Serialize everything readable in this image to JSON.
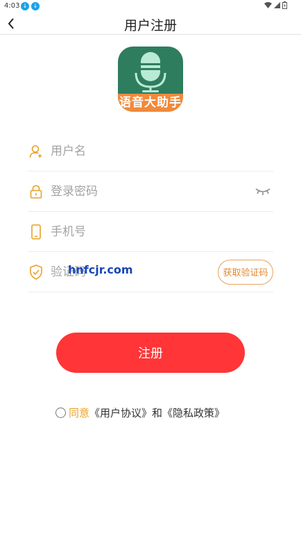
{
  "status_bar": {
    "time": "4:03"
  },
  "header": {
    "title": "用户注册"
  },
  "logo": {
    "text": "语音大助手"
  },
  "form": {
    "username": {
      "placeholder": "用户名"
    },
    "password": {
      "placeholder": "登录密码"
    },
    "phone": {
      "placeholder": "手机号"
    },
    "code": {
      "placeholder": "验证码",
      "button_label": "获取验证码"
    }
  },
  "watermark": "hnfcjr.com",
  "register_button": "注册",
  "agreement": {
    "agree": "同意",
    "user_agreement": "《用户协议》",
    "and": "和",
    "privacy_policy": "《隐私政策》"
  },
  "colors": {
    "accent_red": "#ff3537",
    "accent_orange": "#e8a126",
    "logo_green": "#2f7d5f",
    "logo_band": "#f08a3c"
  }
}
